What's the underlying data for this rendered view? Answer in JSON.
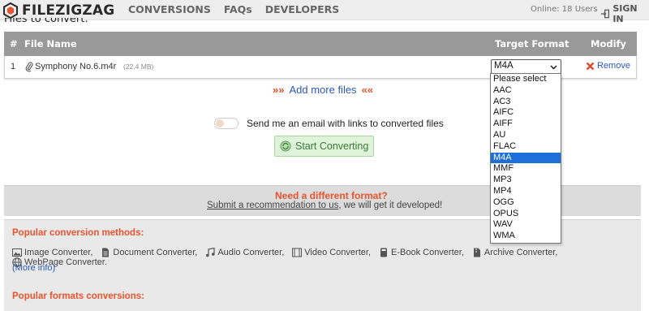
{
  "header": {
    "logo_text": "FILEZIGZAG",
    "nav": [
      "CONVERSIONS",
      "FAQs",
      "DEVELOPERS"
    ],
    "online": "Online: 18 Users",
    "signin": "SIGN IN"
  },
  "files_label": "Files to convert:",
  "table": {
    "headers": {
      "num": "#",
      "file_name": "File Name",
      "target_format": "Target Format",
      "modify": "Modify"
    },
    "rows": [
      {
        "index": "1",
        "name": "Symphony No.6.m4r",
        "size": "(22.4 MB)",
        "format": "M4A",
        "remove": "Remove"
      }
    ]
  },
  "dropdown": {
    "options": [
      "Please select",
      "AAC",
      "AC3",
      "AIFC",
      "AIFF",
      "AU",
      "FLAC",
      "M4A",
      "MMF",
      "MP3",
      "MP4",
      "OGG",
      "OPUS",
      "WAV",
      "WMA"
    ],
    "selected": "M4A"
  },
  "add_more": "Add more files",
  "email_label": "Send me an email with links to converted files",
  "start_button": "Start Converting",
  "need": {
    "title": "Need a different format?",
    "link": "Submit a recommendation to us",
    "rest": ", we will get it developed!"
  },
  "popular": {
    "title": "Popular conversion methods:",
    "items": [
      {
        "label": "Image Converter,",
        "icon": "image-icon"
      },
      {
        "label": "Document Converter,",
        "icon": "document-icon"
      },
      {
        "label": "Audio Converter,",
        "icon": "music-icon"
      },
      {
        "label": "Video Converter,",
        "icon": "film-icon"
      },
      {
        "label": "E-Book Converter,",
        "icon": "book-icon"
      },
      {
        "label": "Archive Converter,",
        "icon": "archive-icon"
      },
      {
        "label": "WebPage Converter.",
        "icon": "globe-icon"
      }
    ],
    "more": "(More info)",
    "formats_title": "Popular formats conversions:"
  },
  "colors": {
    "accent": "#e8542d",
    "link": "#2a58b8",
    "table_header": "#999999",
    "selected_option": "#1e6fd9",
    "start_button_bg": "#dff2da"
  }
}
